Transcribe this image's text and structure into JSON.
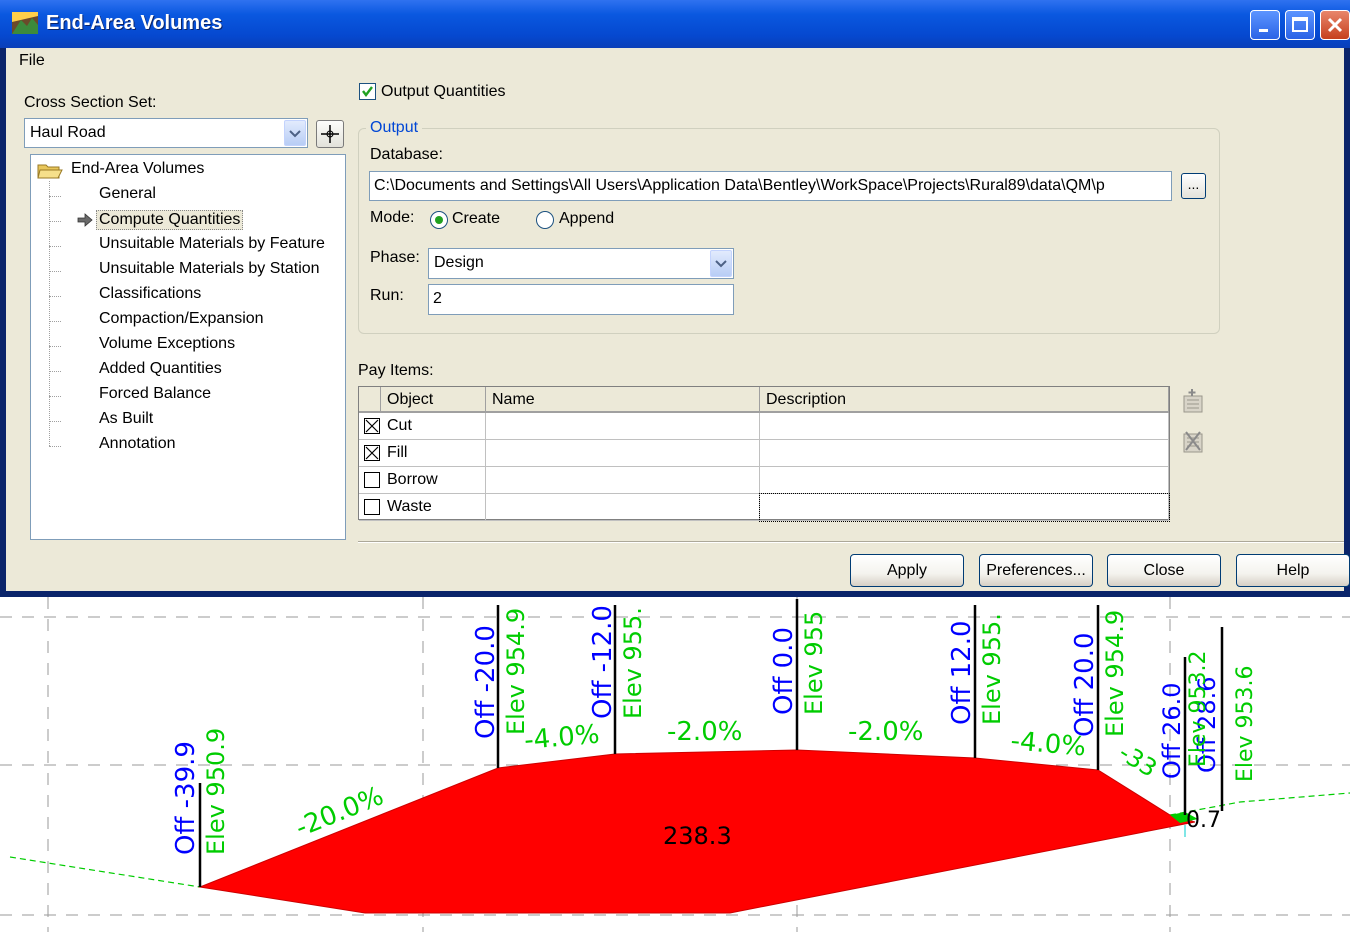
{
  "window": {
    "title": "End-Area Volumes"
  },
  "menu": {
    "file": "File"
  },
  "left": {
    "cross_section_set_label": "Cross Section Set:",
    "cross_section_set_value": "Haul Road",
    "tree_root": "End-Area Volumes",
    "tree_items": [
      "General",
      "Compute Quantities",
      "Unsuitable Materials by Feature",
      "Unsuitable Materials by Station",
      "Classifications",
      "Compaction/Expansion",
      "Volume Exceptions",
      "Added Quantities",
      "Forced Balance",
      "As Built",
      "Annotation"
    ],
    "selected_item": "Compute Quantities"
  },
  "output": {
    "output_quantities_label": "Output Quantities",
    "output_quantities_checked": true,
    "group_title": "Output",
    "database_label": "Database:",
    "database_value": "C:\\Documents and Settings\\All Users\\Application Data\\Bentley\\WorkSpace\\Projects\\Rural89\\data\\QM\\p",
    "browse_label": "...",
    "mode_label": "Mode:",
    "mode_create": "Create",
    "mode_append": "Append",
    "mode_selected": "Create",
    "phase_label": "Phase:",
    "phase_value": "Design",
    "run_label": "Run:",
    "run_value": "2"
  },
  "pay_items": {
    "label": "Pay Items:",
    "columns": [
      "Object",
      "Name",
      "Description"
    ],
    "rows": [
      {
        "object": "Cut",
        "checked": true,
        "name": "",
        "description": ""
      },
      {
        "object": "Fill",
        "checked": true,
        "name": "",
        "description": ""
      },
      {
        "object": "Borrow",
        "checked": false,
        "name": "",
        "description": ""
      },
      {
        "object": "Waste",
        "checked": false,
        "name": "",
        "description": ""
      }
    ]
  },
  "buttons": {
    "apply": "Apply",
    "preferences": "Preferences...",
    "close": "Close",
    "help": "Help"
  },
  "drawing": {
    "area_label": "238.3",
    "slopes": [
      "-20.0%",
      "-4.0%",
      "-2.0%",
      "-2.0%",
      "-4.0%",
      "-33"
    ],
    "offsets": [
      "Off -39.9",
      "Off -20.0",
      "Off -12.0",
      "Off 0.0",
      "Off 12.0",
      "Off 20.0",
      "Off 26.0",
      "Off 28.6"
    ],
    "elevations": [
      "Elev 950.9",
      "Elev 954.9",
      "Elev 955.",
      "Elev 955",
      "Elev 955.",
      "Elev 954.9",
      "Elev 953.2",
      "Elev 953.6"
    ],
    "small_value": "0.7",
    "colors": {
      "fill_area": "#ff0000",
      "offset_text": "#0000ff",
      "elev_text": "#00cc00",
      "ground_line": "#00cc00"
    }
  }
}
